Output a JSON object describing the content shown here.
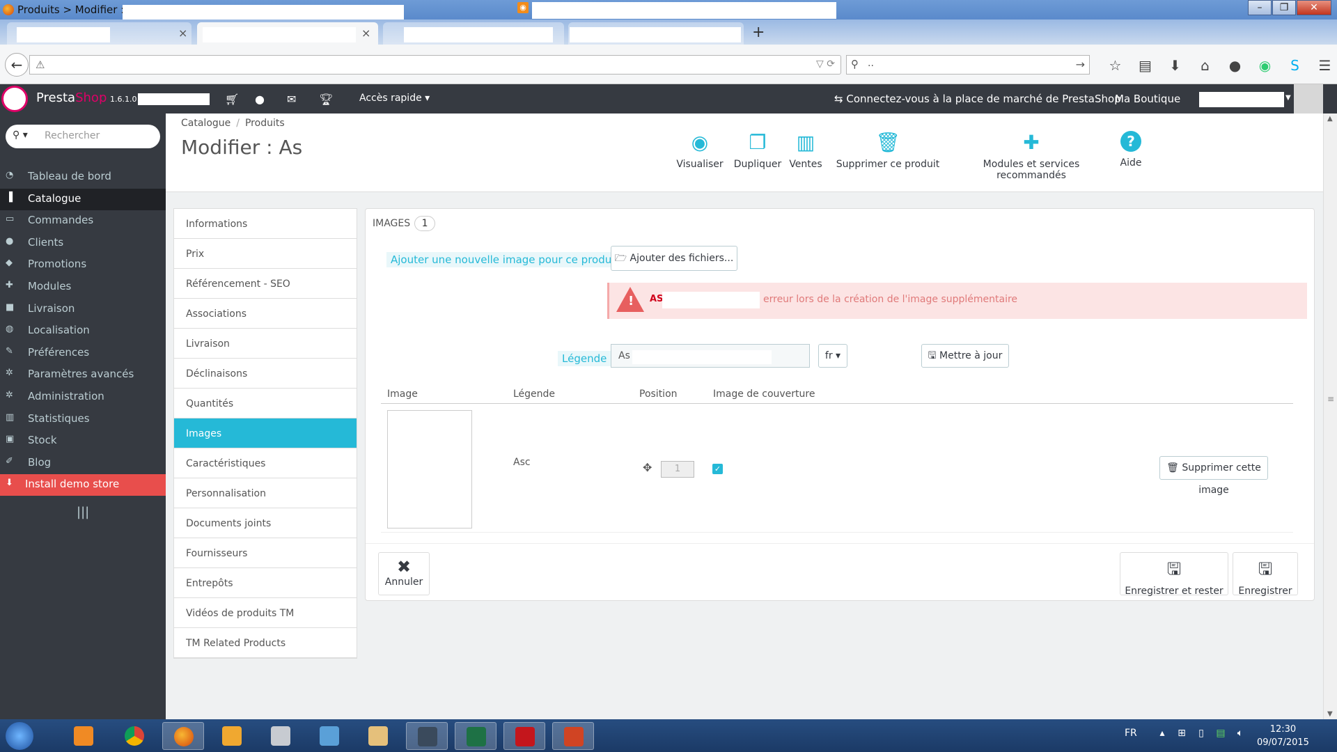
{
  "browser": {
    "window_title": "Produits > Modifier : A",
    "search_value": "..",
    "new_tab": "+",
    "tab_close": "×"
  },
  "ps_header": {
    "brand_presta": "Presta",
    "brand_shop": "Shop",
    "version": "1.6.1.0",
    "quick_access": "Accès rapide ▾",
    "marketplace": "Connectez-vous à la place de marché de PrestaShop",
    "shop_name": "Ma Boutique",
    "brand_color": "#df0067"
  },
  "sidebar": {
    "search_placeholder": "Rechercher",
    "items": [
      {
        "label": "Tableau de bord",
        "icon": "dashboard-icon"
      },
      {
        "label": "Catalogue",
        "icon": "book-icon"
      },
      {
        "label": "Commandes",
        "icon": "credit-card-icon"
      },
      {
        "label": "Clients",
        "icon": "users-icon"
      },
      {
        "label": "Promotions",
        "icon": "tags-icon"
      },
      {
        "label": "Modules",
        "icon": "puzzle-icon"
      },
      {
        "label": "Livraison",
        "icon": "truck-icon"
      },
      {
        "label": "Localisation",
        "icon": "globe-icon"
      },
      {
        "label": "Préférences",
        "icon": "wrench-icon"
      },
      {
        "label": "Paramètres avancés",
        "icon": "cogs-icon"
      },
      {
        "label": "Administration",
        "icon": "cog-icon"
      },
      {
        "label": "Statistiques",
        "icon": "bar-chart-icon"
      },
      {
        "label": "Stock",
        "icon": "archive-icon"
      },
      {
        "label": "Blog",
        "icon": "edit-icon"
      },
      {
        "label": "Install demo store",
        "icon": "download-icon"
      }
    ]
  },
  "toolbar": {
    "breadcrumb_1": "Catalogue",
    "breadcrumb_sep": "/",
    "breadcrumb_2": "Produits",
    "title": "Modifier : As",
    "buttons": [
      {
        "label": "Visualiser",
        "icon": "eye-icon"
      },
      {
        "label": "Dupliquer",
        "icon": "copy-icon"
      },
      {
        "label": "Ventes",
        "icon": "bar-chart-icon"
      },
      {
        "label": "Supprimer ce produit",
        "icon": "trash-icon"
      },
      {
        "label": "Modules et services recommandés",
        "icon": "puzzle-icon"
      },
      {
        "label": "Aide",
        "icon": "help-icon"
      }
    ],
    "accent_color": "#25b9d7"
  },
  "product_tabs": [
    "Informations",
    "Prix",
    "Référencement - SEO",
    "Associations",
    "Livraison",
    "Déclinaisons",
    "Quantités",
    "Images",
    "Caractéristiques",
    "Personnalisation",
    "Documents joints",
    "Fournisseurs",
    "Entrepôts",
    "Vidéos de produits TM",
    "TM Related Products"
  ],
  "panel": {
    "heading": "Images",
    "count": "1",
    "add_label": "Ajouter une nouvelle image pour ce produit",
    "add_files": "Ajouter des fichiers...",
    "alert_name": "AS",
    "alert_message": "erreur lors de la création de l'image supplémentaire",
    "legend_label": "Légende",
    "legend_value": "As",
    "lang": "fr ▾",
    "update": "Mettre à jour",
    "columns": [
      "Image",
      "Légende",
      "Position",
      "Image de couverture"
    ],
    "row": {
      "caption": "Asc",
      "position": "1",
      "cover": true
    },
    "delete_image": "Supprimer cette image",
    "cancel": "Annuler",
    "save_stay": "Enregistrer et rester",
    "save": "Enregistrer"
  },
  "taskbar": {
    "language": "FR",
    "time": "12:30",
    "date": "09/07/2015"
  }
}
